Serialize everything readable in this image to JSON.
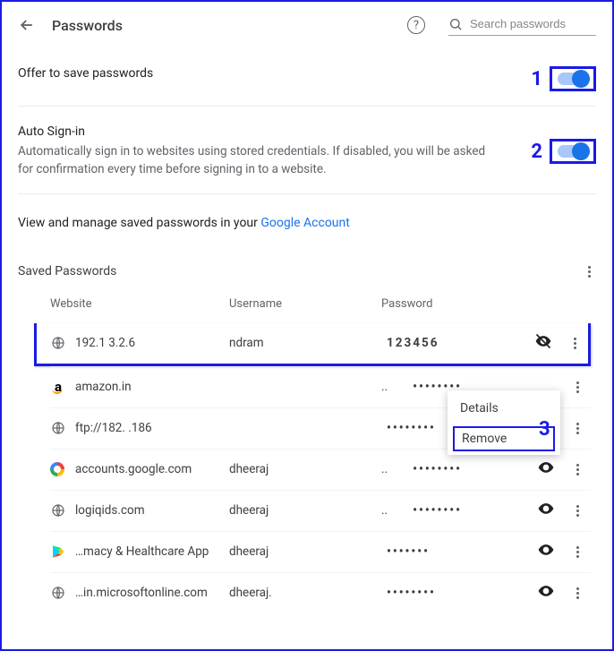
{
  "header": {
    "title": "Passwords",
    "search_placeholder": "Search passwords"
  },
  "settings": {
    "offer_save": {
      "title": "Offer to save passwords",
      "on": true
    },
    "auto_signin": {
      "title": "Auto Sign-in",
      "desc": "Automatically sign in to websites using stored credentials. If disabled, you will be asked for confirmation every time before signing in to a website.",
      "on": true
    }
  },
  "manage_text_prefix": "View and manage saved passwords in your ",
  "manage_link_text": "Google Account",
  "saved_section_title": "Saved Passwords",
  "columns": {
    "website": "Website",
    "username": "Username",
    "password": "Password"
  },
  "rows": [
    {
      "icon": "globe",
      "website": "192.1    3.2.6",
      "username": "ndram",
      "password": "123456",
      "eye": "hidden"
    },
    {
      "icon": "amazon",
      "website": "amazon.in",
      "username_prefix": "..",
      "password": "••••••••",
      "eye": "none"
    },
    {
      "icon": "globe",
      "website": "ftp://182.         .186",
      "username": "",
      "password": "••••••••",
      "eye": "none"
    },
    {
      "icon": "google",
      "website": "accounts.google.com",
      "username_prefix": "..",
      "username": "dheeraj",
      "password": "••••••••",
      "eye": "visible"
    },
    {
      "icon": "globe",
      "website": "logiqids.com",
      "username_prefix": "..",
      "username": "dheeraj",
      "password": "••••••••",
      "eye": "visible"
    },
    {
      "icon": "play",
      "website": "…macy & Healthcare App",
      "username": "dheeraj",
      "password": "•••••••",
      "eye": "visible"
    },
    {
      "icon": "globe",
      "website": "…in.microsoftonline.com",
      "username": "dheeraj.",
      "password": "••••••••",
      "eye": "visible"
    }
  ],
  "context_menu": {
    "details": "Details",
    "remove": "Remove"
  },
  "annotations": {
    "one": "1",
    "two": "2",
    "three": "3"
  }
}
